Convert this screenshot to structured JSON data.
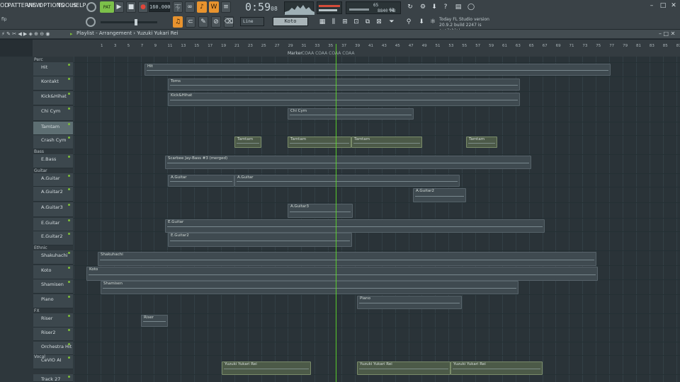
{
  "menu": [
    "OD",
    "PATTERNS",
    "VIEW",
    "OPTIONS",
    "TOOLS",
    "HELP"
  ],
  "transport": {
    "tempo": "160.000",
    "time": "0:59",
    "time_sub": "08",
    "cpu": "65",
    "memory": "8840 MB",
    "poly": "62",
    "snap": "Line",
    "channel": "Koto"
  },
  "news": {
    "line1": "Today   FL Studio version",
    "line2": "20.9.2 build 2247 is available!"
  },
  "search": {
    "value": "flp"
  },
  "playlist": {
    "title": "Playlist - Arrangement › Yuzuki Yukari Rei",
    "markers": "Marker",
    "ruler": [
      "1",
      "3",
      "5",
      "7",
      "9",
      "11",
      "13",
      "15",
      "17",
      "19",
      "21",
      "23",
      "25",
      "27",
      "29",
      "31",
      "33",
      "35",
      "37",
      "39",
      "41",
      "43",
      "45",
      "47",
      "49",
      "51",
      "53",
      "55",
      "57",
      "59",
      "61",
      "63",
      "65",
      "67",
      "69",
      "71",
      "73",
      "75",
      "77",
      "79",
      "81",
      "83",
      "85",
      "87",
      "89",
      "91"
    ]
  },
  "groups": [
    {
      "label": "Perc"
    },
    {
      "label": "Bass"
    },
    {
      "label": "Guitar"
    },
    {
      "label": "Ethnic"
    },
    {
      "label": "FX"
    },
    {
      "label": "Vocal"
    }
  ],
  "tracks": [
    {
      "name": "Hit"
    },
    {
      "name": "Kontakt"
    },
    {
      "name": "Kick&Hihat"
    },
    {
      "name": "Chi Cym"
    },
    {
      "name": "Tamtam"
    },
    {
      "name": "Crash Cym"
    },
    {
      "name": "E.Bass"
    },
    {
      "name": "A.Guitar"
    },
    {
      "name": "A.Guitar2"
    },
    {
      "name": "A.Guitar3"
    },
    {
      "name": "E.Guitar"
    },
    {
      "name": "E.Guitar2"
    },
    {
      "name": "Shakuhachi"
    },
    {
      "name": "Koto"
    },
    {
      "name": "Shamisen"
    },
    {
      "name": "Piano"
    },
    {
      "name": "Riser"
    },
    {
      "name": "Riser2"
    },
    {
      "name": "Orchestra Hit"
    },
    {
      "name": "CeVIO AI"
    },
    {
      "name": "Track 27"
    }
  ],
  "clips": [
    {
      "label": "Hit"
    },
    {
      "label": "Toms"
    },
    {
      "label": "Kick&Hihat"
    },
    {
      "label": "Chi Cym"
    },
    {
      "label": "Tamtam"
    },
    {
      "label": "Tamtam"
    },
    {
      "label": "Tamtam"
    },
    {
      "label": "Tamtam"
    },
    {
      "label": "Scarbee Jay-Bass #3 (merged)"
    },
    {
      "label": "A.Guitar"
    },
    {
      "label": "A.Guitar"
    },
    {
      "label": "A.Guitar2"
    },
    {
      "label": "A.Guitar3"
    },
    {
      "label": "E.Guitar"
    },
    {
      "label": "E.Guitar2"
    },
    {
      "label": "Shakuhachi"
    },
    {
      "label": "Koto"
    },
    {
      "label": "Shamisen"
    },
    {
      "label": "Piano"
    },
    {
      "label": "Riser"
    },
    {
      "label": "Yuzuki Yukari Rei"
    },
    {
      "label": "Yuzuki Yukari Rei"
    },
    {
      "label": "Yuzuki Yukari Rei"
    }
  ],
  "colors": {
    "accent": "#e8932e",
    "playhead": "#5edc2a",
    "selected_track": "#5d6e72"
  },
  "icons": [
    "play-icon",
    "stop-icon",
    "record-icon",
    "pattern-song-toggle-icon",
    "metronome-icon",
    "pencil-icon",
    "paint-icon",
    "delete-icon",
    "mute-icon",
    "slip-icon",
    "zoom-icon",
    "magnet-icon",
    "piano-roll-icon",
    "mixer-icon",
    "channel-rack-icon",
    "browser-icon",
    "plugin-icon",
    "undo-icon",
    "save-icon",
    "cpu-icon",
    "help-icon",
    "chat-icon",
    "minimize-icon",
    "maximize-icon",
    "close-icon"
  ]
}
